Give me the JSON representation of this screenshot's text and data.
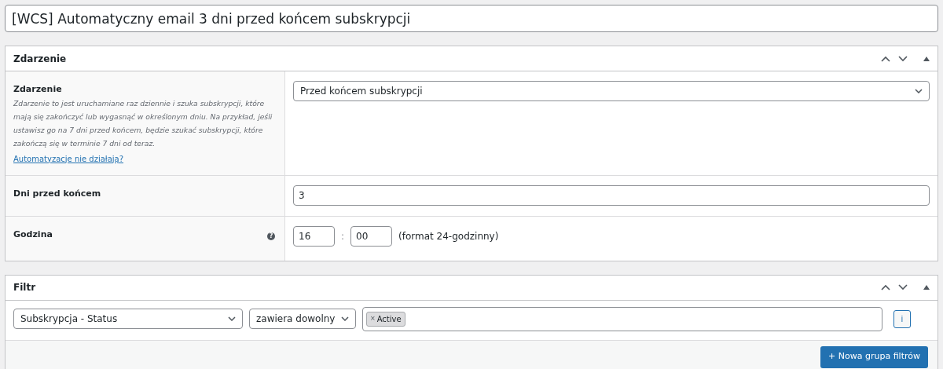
{
  "title_field": {
    "value": "[WCS] Automatyczny email 3 dni przed końcem subskrypcji"
  },
  "panels": [
    {
      "kind": "trigger",
      "title": "Zdarzenie",
      "fields": [
        {
          "kind": "select",
          "label": "Zdarzenie",
          "description": "Zdarzenie to jest uruchamiane raz dziennie i szuka subskrypcji, które mają się zakończyć lub wygasnąć w określonym dniu. Na przykład, jeśli ustawisz go na 7 dni przed końcem, będzie szukać subskrypcji, które zakończą się w terminie 7 dni od teraz.",
          "link": "Automatyzacje nie działają?",
          "value": "Przed końcem subskrypcji"
        },
        {
          "kind": "text",
          "label": "Dni przed końcem",
          "value": "3"
        },
        {
          "kind": "time",
          "label": "Godzina",
          "help": "?",
          "hours": "16",
          "separator": ":",
          "minutes": "00",
          "note": "(format 24-godzinny)"
        }
      ]
    },
    {
      "kind": "filters",
      "title": "Filtr",
      "filter": {
        "field": "Subskrypcja - Status",
        "operator": "zawiera dowolny",
        "tags": [
          {
            "remove": "×",
            "label": "Active"
          }
        ],
        "info_button": "i"
      },
      "add_button": "+ Nowa grupa filtrów"
    }
  ]
}
